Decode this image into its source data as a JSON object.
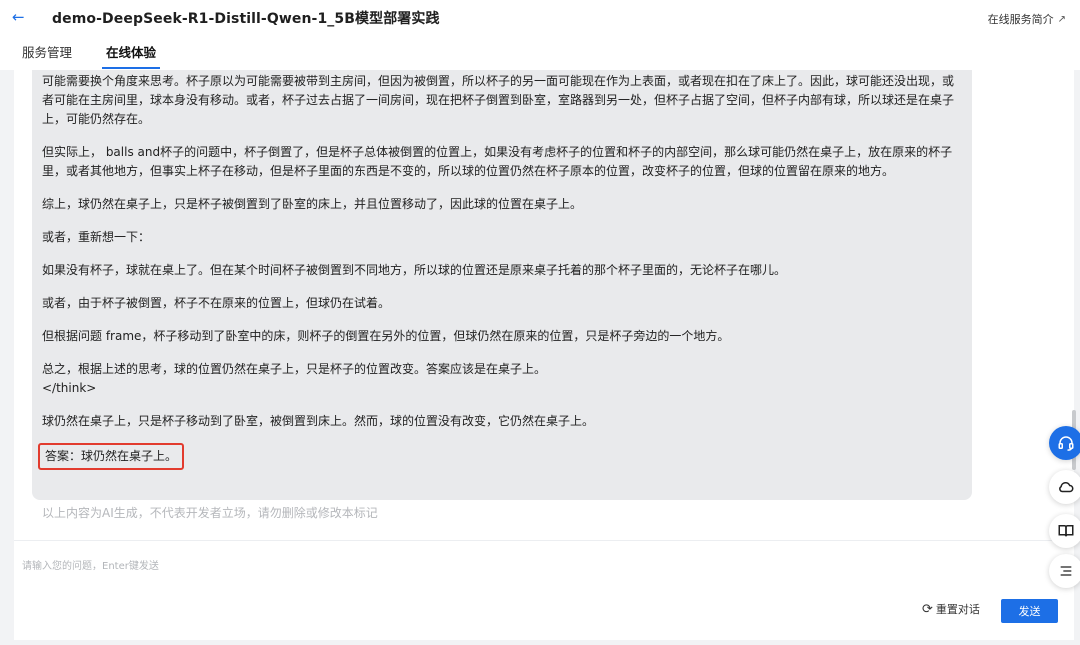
{
  "header": {
    "title": "demo-DeepSeek-R1-Distill-Qwen-1_5B模型部署实践",
    "intro_link": "在线服务简介",
    "tabs": [
      {
        "label": "服务管理"
      },
      {
        "label": "在线体验"
      }
    ]
  },
  "chat": {
    "paragraphs": [
      "可能需要换个角度来思考。杯子原以为可能需要被带到主房间，但因为被倒置，所以杯子的另一面可能现在作为上表面，或者现在扣在了床上了。因此，球可能还没出现，或者可能在主房间里，球本身没有移动。或者，杯子过去占据了一间房间，现在把杯子倒置到卧室，室路器到另一处，但杯子占据了空间，但杯子内部有球，所以球还是在桌子上，可能仍然存在。",
      "但实际上， balls and杯子的问题中，杯子倒置了，但是杯子总体被倒置的位置上，如果没有考虑杯子的位置和杯子的内部空间，那么球可能仍然在桌子上，放在原来的杯子里，或者其他地方，但事实上杯子在移动，但是杯子里面的东西是不变的，所以球的位置仍然在杯子原本的位置，改变杯子的位置，但球的位置留在原来的地方。",
      "综上，球仍然在桌子上，只是杯子被倒置到了卧室的床上，并且位置移动了，因此球的位置在桌子上。",
      "或者，重新想一下：",
      "如果没有杯子，球就在桌上了。但在某个时间杯子被倒置到不同地方，所以球的位置还是原来桌子托着的那个杯子里面的，无论杯子在哪儿。",
      "或者，由于杯子被倒置，杯子不在原来的位置上，但球仍在试着。",
      "但根据问题 frame，杯子移动到了卧室中的床，则杯子的倒置在另外的位置，但球仍然在原来的位置，只是杯子旁边的一个地方。",
      "总之，根据上述的思考，球的位置仍然在桌子上，只是杯子的位置改变。答案应该是在桌子上。"
    ],
    "think_close": "</think>",
    "summary": "球仍然在桌子上，只是杯子移动到了卧室，被倒置到床上。然而，球的位置没有改变，它仍然在桌子上。",
    "final_answer": "答案：球仍然在桌子上。",
    "disclaimer": "以上内容为AI生成，不代表开发者立场，请勿删除或修改本标记"
  },
  "input": {
    "placeholder": "请输入您的问题，Enter键发送",
    "value": ""
  },
  "actions": {
    "reset_label": "重置对话",
    "send_label": "发送"
  },
  "colors": {
    "accent": "#1d6fe6",
    "highlight_border": "#e23b2e",
    "bubble_bg": "#e9eaec"
  },
  "icons": {
    "back": "arrow-left-icon",
    "external": "external-link-icon",
    "reset": "refresh-icon",
    "tools": [
      "headset-icon",
      "cloud-icon",
      "book-icon",
      "list-icon"
    ]
  }
}
